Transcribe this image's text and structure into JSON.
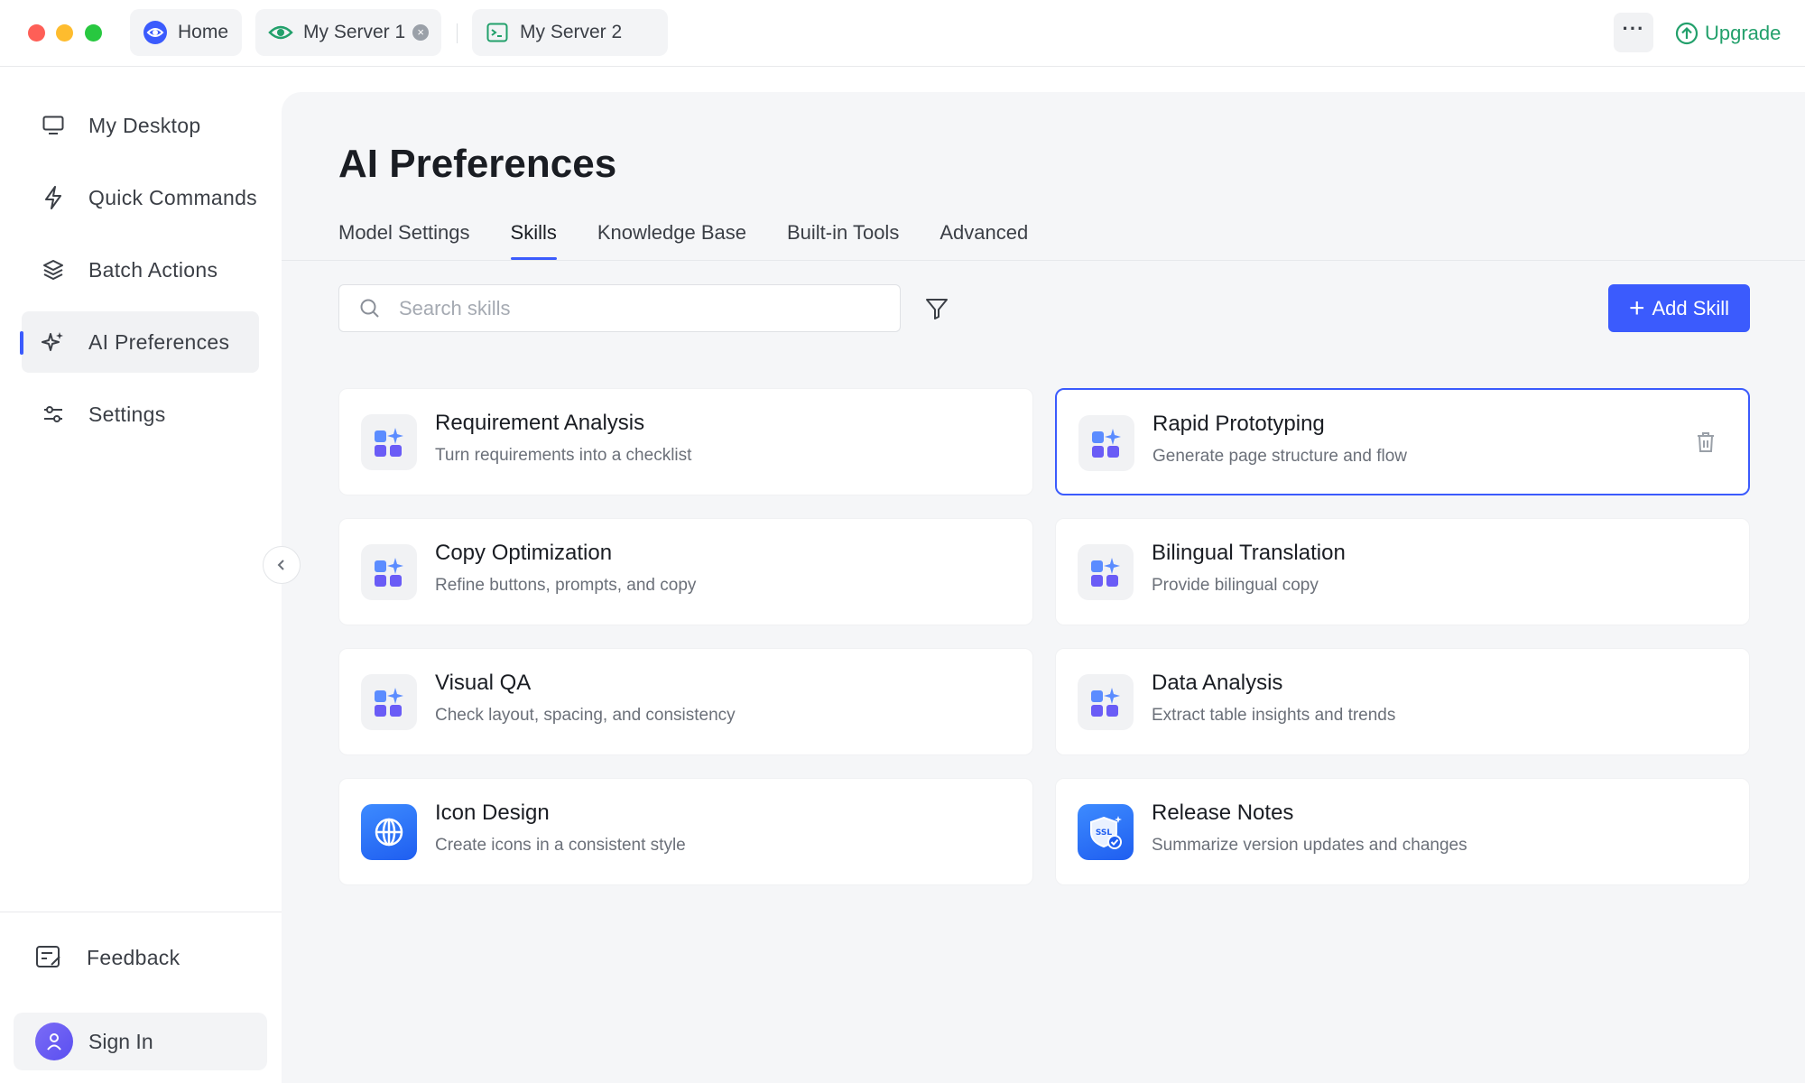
{
  "window": {
    "tabs": [
      {
        "label": "Home",
        "icon": "eye-icon"
      },
      {
        "label": "My Server 1",
        "icon": "eye-icon",
        "closable": true
      },
      {
        "label": "My Server 2",
        "icon": "terminal-icon"
      }
    ],
    "more_label": "···",
    "upgrade_label": "Upgrade",
    "upgrade_color": "#22a06b"
  },
  "sidebar": {
    "items": [
      {
        "label": "My Desktop",
        "icon": "monitor-icon"
      },
      {
        "label": "Quick Commands",
        "icon": "lightning-icon"
      },
      {
        "label": "Batch Actions",
        "icon": "layers-icon"
      },
      {
        "label": "AI Preferences",
        "icon": "sparkle-icon",
        "active": true
      },
      {
        "label": "Settings",
        "icon": "sliders-icon"
      }
    ],
    "feedback_label": "Feedback",
    "signin_label": "Sign In"
  },
  "main": {
    "title": "AI Preferences",
    "tabs": [
      {
        "label": "Model Settings"
      },
      {
        "label": "Skills",
        "active": true
      },
      {
        "label": "Knowledge Base"
      },
      {
        "label": "Built-in Tools"
      },
      {
        "label": "Advanced"
      }
    ],
    "search": {
      "placeholder": "Search skills",
      "value": ""
    },
    "add_button_label": "Add Skill",
    "accent_color": "#3b5bfd",
    "skills": [
      {
        "title": "Requirement Analysis",
        "desc": "Turn requirements into a checklist",
        "icon": "apps-sparkle-icon"
      },
      {
        "title": "Rapid Prototyping",
        "desc": "Generate page structure and flow",
        "icon": "apps-sparkle-icon",
        "selected": true
      },
      {
        "title": "Copy Optimization",
        "desc": "Refine buttons, prompts, and copy",
        "icon": "apps-sparkle-icon"
      },
      {
        "title": "Bilingual Translation",
        "desc": "Provide bilingual copy",
        "icon": "apps-sparkle-icon"
      },
      {
        "title": "Visual QA",
        "desc": "Check layout, spacing, and consistency",
        "icon": "apps-sparkle-icon"
      },
      {
        "title": "Data Analysis",
        "desc": "Extract table insights and trends",
        "icon": "apps-sparkle-icon"
      },
      {
        "title": "Icon Design",
        "desc": "Create icons in a consistent style",
        "icon": "globe-icon"
      },
      {
        "title": "Release Notes",
        "desc": "Summarize version updates and changes",
        "icon": "ssl-shield-icon",
        "badge_text": "SSL"
      }
    ]
  }
}
